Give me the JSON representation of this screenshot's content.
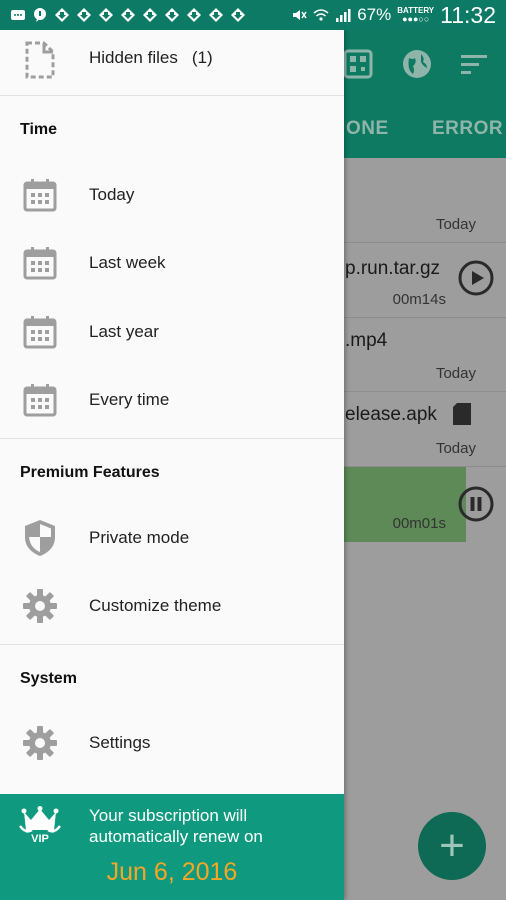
{
  "status_bar": {
    "battery_percent": "67%",
    "battery_label": "BATTERY",
    "time": "11:32"
  },
  "background_app": {
    "tabs": [
      "ONE",
      "ERROR"
    ],
    "rows": [
      {
        "name": "",
        "meta": "Today"
      },
      {
        "name": "p.run.tar.gz",
        "meta": "00m14s"
      },
      {
        "name": ".mp4",
        "meta": "Today"
      },
      {
        "name": "elease.apk",
        "meta": "Today"
      },
      {
        "name": "",
        "meta": "00m01s"
      }
    ],
    "fab_label": "+"
  },
  "drawer": {
    "top_item": {
      "label": "Hidden files",
      "count": "(1)",
      "icon": "file-outline-icon"
    },
    "sections": [
      {
        "header": "Time",
        "items": [
          {
            "label": "Today",
            "icon": "calendar-icon"
          },
          {
            "label": "Last week",
            "icon": "calendar-icon"
          },
          {
            "label": "Last year",
            "icon": "calendar-icon"
          },
          {
            "label": "Every time",
            "icon": "calendar-icon"
          }
        ]
      },
      {
        "header": "Premium Features",
        "items": [
          {
            "label": "Private mode",
            "icon": "shield-icon"
          },
          {
            "label": "Customize theme",
            "icon": "gear-icon"
          }
        ]
      },
      {
        "header": "System",
        "items": [
          {
            "label": "Settings",
            "icon": "gear-icon"
          }
        ]
      }
    ],
    "vip": {
      "badge_text": "VIP",
      "message": "Your subscription will automatically renew on",
      "date": "Jun 6, 2016"
    }
  },
  "colors": {
    "accent": "#0f9a80",
    "status_bar": "#0c7a64",
    "vip_date": "#f6a623"
  }
}
